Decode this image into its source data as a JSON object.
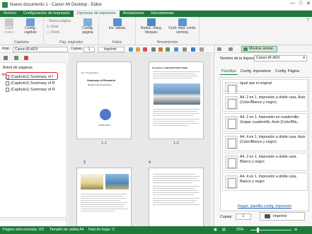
{
  "window": {
    "title": "Nuevo documento 1 - Canon iW Desktop - Editor",
    "controls": [
      "—",
      "□",
      "✕"
    ]
  },
  "ribbon": {
    "tabs": [
      "Archivo",
      "Configuración de impresión",
      "Opciones de impresión",
      "Anotaciones",
      "Herramientas"
    ],
    "active_tab": "Opciones de impresión",
    "groups": {
      "capitulos": {
        "label": "Capítulos",
        "nuevo": "Capít. nuevo",
        "config": "Config. capítulo"
      },
      "paginas": {
        "label": "Pág. originales",
        "nueva_pagina": "Nueva página",
        "girar": "Girar",
        "divid": "Divid.",
        "config_pagina": "Config. página"
      },
      "indice": {
        "label": "Índice",
        "ins_tab": "Ins. tabula."
      },
      "herramientas": {
        "label": "Herramientas",
        "reduc": "Reduc. márg. bloques",
        "conf_impr": "Conf. impr. comb. corresp."
      }
    }
  },
  "toolbar": {
    "impr_label": "Impr.:",
    "impr_value": "Canon iR-ADV",
    "copias_label": "Copias:",
    "copias_value": "1",
    "imprimir": "Imprimir"
  },
  "left_pane": {
    "title": "Árbol de páginas",
    "items": [
      "(Capítulo1) Summary of I",
      "(Capítulo1) Summary of R",
      "(Capítulo1) Summary of R"
    ]
  },
  "canvas": {
    "page_labels": [
      "1-1",
      "1-2",
      "3",
      "4"
    ],
    "p1_title": "Summary of Research",
    "p1_sub": "Results of the Annual Survey",
    "p1_corner": "No. 3 Corporation",
    "p1_date": "FY2012 2013",
    "p2_title": "Introduction to RELEVANT ROOF FINISH"
  },
  "right_pane": {
    "mostrar": "Mostrar anotac.",
    "printer_label": "Nombre de la impresora:",
    "printer_value": "Canon iR-ADV",
    "tabs": [
      "Plantillas",
      "Config. impresione",
      "Config. Página"
    ],
    "active_tab": "Plantillas",
    "templates": [
      "Igual que el original",
      "A4, 2 en 1, Impresión a doble cara, Auto (Color/Blanco y negro)",
      "A4, 2 en 1, Impresión en cuadernillo, Grapar cuadernillo, Auto (Color/Bla...",
      "A4, 4 en 1, Impresión a doble cara, Auto (Color/Blanco y negro)",
      "A4, 2 en 1, Impresión a doble cara, Blanco y negro",
      "A4, 4 en 1, Impresión a doble cara, Blanco y negro"
    ],
    "reset_link": "Regist. plantilla config. Impresión",
    "copias_label": "Copias:",
    "copias_value": "1",
    "print_button": "Imprimir"
  },
  "status": {
    "paginas_sel": "Página seleccionada :3/3",
    "tamano": "Tamaño de salida:A4",
    "total": "Total de hojas :3",
    "zoom": "25%"
  },
  "colors": {
    "brand_green": "#1e7a3a",
    "highlight": "#e02020"
  }
}
